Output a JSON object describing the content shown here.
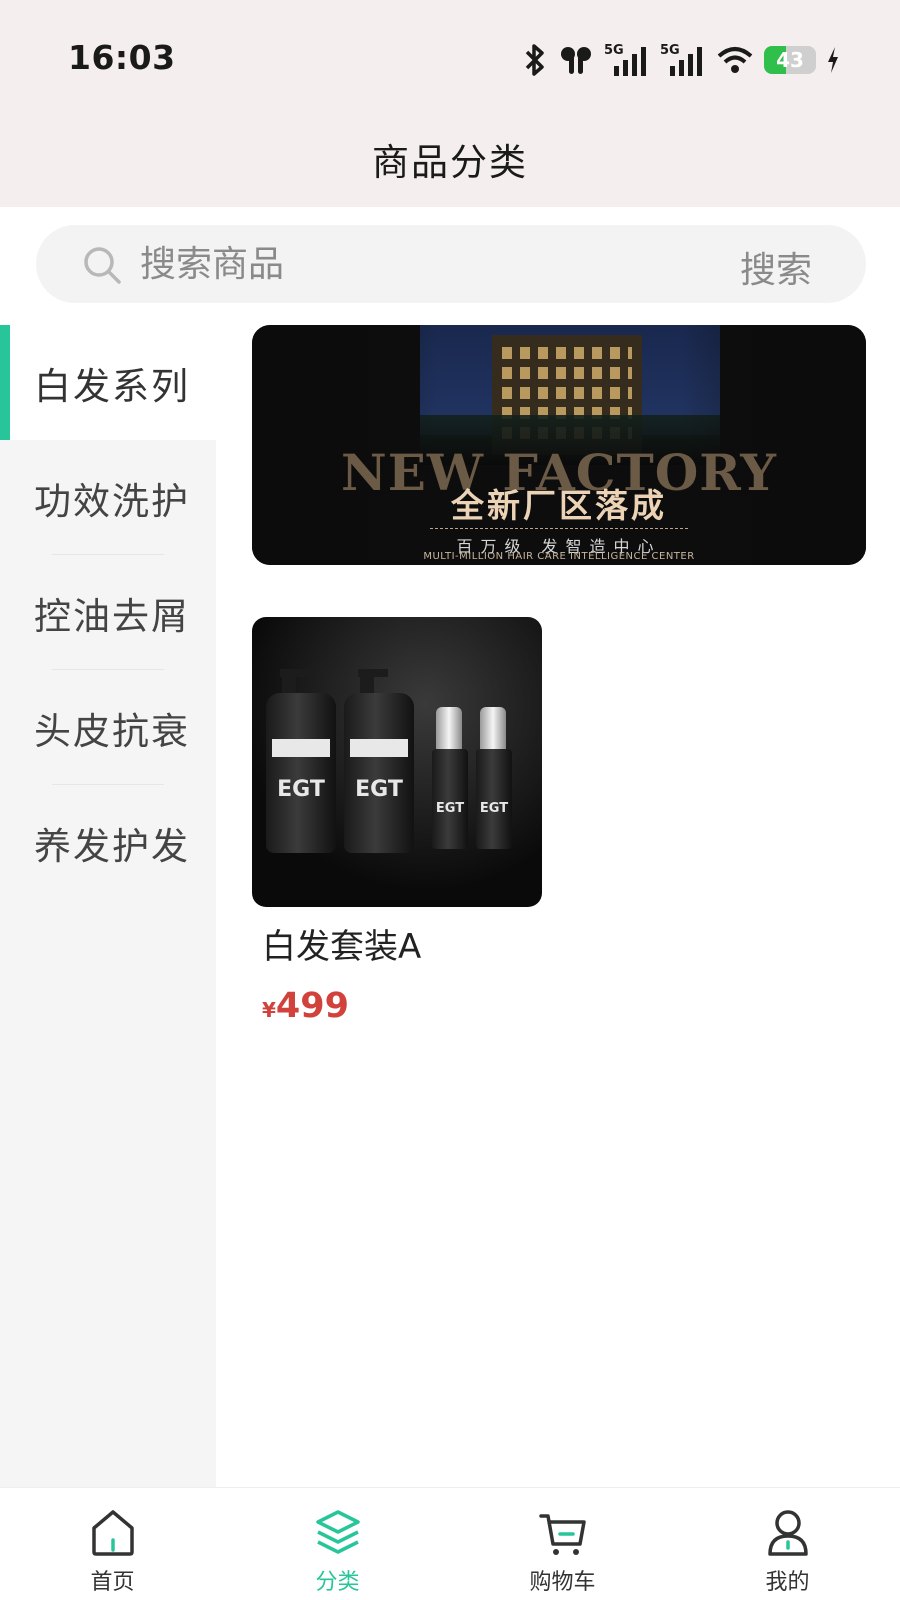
{
  "status_bar": {
    "time": "16:03",
    "battery_level": "43",
    "battery_fraction": 0.43,
    "network": [
      "5G",
      "5G"
    ]
  },
  "header": {
    "title": "商品分类"
  },
  "search": {
    "placeholder": "搜索商品",
    "button_label": "搜索"
  },
  "categories": [
    {
      "label": "白发系列",
      "active": true
    },
    {
      "label": "功效洗护",
      "active": false
    },
    {
      "label": "控油去屑",
      "active": false
    },
    {
      "label": "头皮抗衰",
      "active": false
    },
    {
      "label": "养发护发",
      "active": false
    }
  ],
  "banner": {
    "headline_en": "NEW FACTORY",
    "headline_cn": "全新厂区落成",
    "subtitle_cn": "百万级  发智造中心",
    "subtitle_en": "MULTI-MILLION HAIR CARE INTELLIGENCE CENTER"
  },
  "products": [
    {
      "name": "白发套装A",
      "currency": "¥",
      "price": "499",
      "image_brand": "EGT"
    }
  ],
  "tabbar": {
    "items": [
      {
        "label": "首页",
        "icon": "home-icon",
        "active": false
      },
      {
        "label": "分类",
        "icon": "layers-icon",
        "active": true
      },
      {
        "label": "购物车",
        "icon": "cart-icon",
        "active": false
      },
      {
        "label": "我的",
        "icon": "user-icon",
        "active": false
      }
    ]
  },
  "colors": {
    "accent": "#29c59a",
    "price": "#d0423b",
    "header_bg": "#f4efee",
    "sidebar_bg": "#f5f5f5"
  }
}
